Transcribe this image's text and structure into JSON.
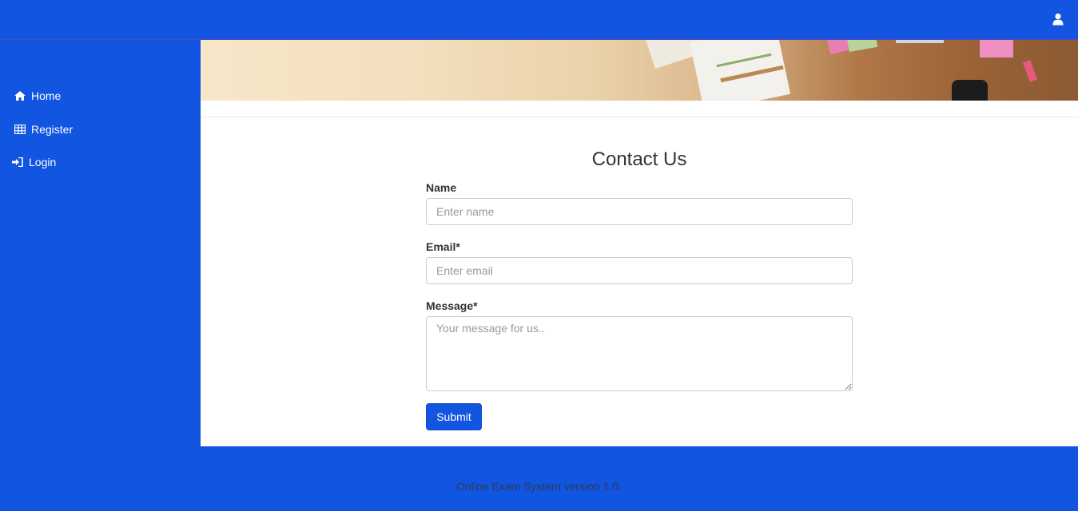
{
  "header": {
    "user_icon": "user-icon"
  },
  "sidebar": {
    "items": [
      {
        "label": "Home",
        "icon": "home-icon"
      },
      {
        "label": "Register",
        "icon": "table-icon"
      },
      {
        "label": "Login",
        "icon": "sign-in-icon"
      }
    ]
  },
  "banner": {
    "image": "office desk photo banner"
  },
  "form": {
    "title": "Contact Us",
    "name_label": "Name",
    "name_placeholder": "Enter name",
    "name_value": "",
    "email_label": "Email",
    "email_required": "*",
    "email_placeholder": "Enter email",
    "email_value": "",
    "message_label": "Message",
    "message_required": "*",
    "message_placeholder": "Your message for us..",
    "message_value": "",
    "submit_label": "Submit"
  },
  "footer": {
    "text": "Online Exam System version 1.0."
  },
  "colors": {
    "primary": "#1155e0",
    "text": "#333333",
    "footer_text": "#2d3a5a"
  }
}
